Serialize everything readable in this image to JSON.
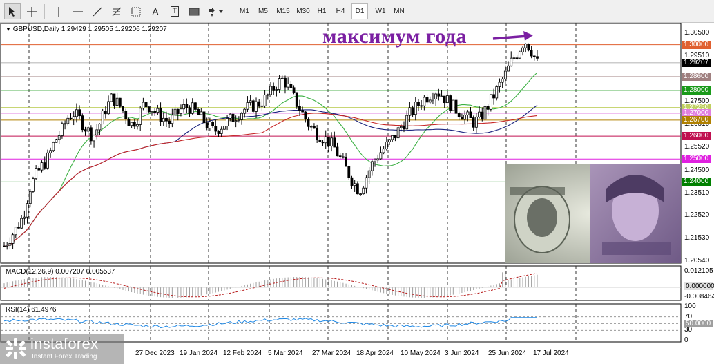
{
  "toolbar": {
    "tools": [
      {
        "name": "cursor-tool",
        "icon": "cursor-icon"
      },
      {
        "name": "crosshair-tool",
        "icon": "crosshair-icon"
      },
      {
        "name": "vertical-line-tool",
        "icon": "vertical-line-icon"
      },
      {
        "name": "horizontal-line-tool",
        "icon": "horizontal-line-icon"
      },
      {
        "name": "trend-line-tool",
        "icon": "trend-line-icon"
      },
      {
        "name": "fibonacci-tool",
        "icon": "fibonacci-icon"
      },
      {
        "name": "channel-tool",
        "icon": "channel-icon"
      },
      {
        "name": "text-tool",
        "icon": "text-icon",
        "label": "A"
      },
      {
        "name": "text-label-tool",
        "icon": "text-label-icon",
        "label": "T"
      },
      {
        "name": "rectangle-tool",
        "icon": "rectangle-icon"
      },
      {
        "name": "shapes-menu",
        "icon": "shapes-icon"
      }
    ],
    "timeframes": [
      "M1",
      "M5",
      "M15",
      "M30",
      "H1",
      "H4",
      "D1",
      "W1",
      "MN"
    ],
    "active_timeframe": "D1"
  },
  "chart": {
    "header": "GBPUSD,Daily  1.29429 1.29505 1.29206 1.29207",
    "annotation": "максимум года",
    "price_axis": [
      "1.30500",
      "1.29510",
      "1.27500",
      "1.26510",
      "1.25520",
      "1.24500",
      "1.23510",
      "1.22520",
      "1.21530",
      "1.20540"
    ],
    "price_tags": [
      {
        "label": "1.30000",
        "color": "#e06030"
      },
      {
        "label": "1.29207",
        "color": "#000000"
      },
      {
        "label": "1.28600",
        "color": "#a08080"
      },
      {
        "label": "1.28000",
        "color": "#1a9a1a"
      },
      {
        "label": "1.27250",
        "color": "#c0d060"
      },
      {
        "label": "1.27000",
        "color": "#e080e0"
      },
      {
        "label": "1.26700",
        "color": "#b08000"
      },
      {
        "label": "1.26000",
        "color": "#c01050"
      },
      {
        "label": "1.25000",
        "color": "#e020e0"
      },
      {
        "label": "1.24000",
        "color": "#008000"
      }
    ],
    "date_axis": [
      "27 Dec 2023",
      "19 Jan 2024",
      "12 Feb 2024",
      "5 Mar 2024",
      "27 Mar 2024",
      "18 Apr 2024",
      "10 May 2024",
      "3 Jun 2024",
      "25 Jun 2024",
      "17 Jul 2024"
    ]
  },
  "macd": {
    "label": "MACD(12,26,9) 0.007207 0.005537",
    "axis": [
      "0.012105",
      "0.000000",
      "-0.008464"
    ]
  },
  "rsi": {
    "label": "RSI(14) 61.4976",
    "axis": [
      "100",
      "70",
      "50.0000",
      "30",
      "0"
    ]
  },
  "watermark": {
    "name": "instaforex",
    "tagline": "Instant Forex Trading"
  },
  "chart_data": {
    "type": "candlestick",
    "symbol": "GBPUSD",
    "timeframe": "Daily",
    "last_ohlc": {
      "open": 1.29429,
      "high": 1.29505,
      "low": 1.29206,
      "close": 1.29207
    },
    "closes": [
      1.212,
      1.216,
      1.22,
      1.225,
      1.237,
      1.243,
      1.247,
      1.251,
      1.258,
      1.262,
      1.268,
      1.27,
      1.267,
      1.263,
      1.26,
      1.265,
      1.272,
      1.277,
      1.274,
      1.27,
      1.265,
      1.268,
      1.274,
      1.273,
      1.27,
      1.268,
      1.266,
      1.269,
      1.272,
      1.273,
      1.271,
      1.268,
      1.265,
      1.262,
      1.264,
      1.266,
      1.268,
      1.27,
      1.272,
      1.273,
      1.274,
      1.276,
      1.279,
      1.283,
      1.285,
      1.28,
      1.275,
      1.27,
      1.265,
      1.262,
      1.26,
      1.258,
      1.255,
      1.25,
      1.245,
      1.24,
      1.236,
      1.242,
      1.248,
      1.252,
      1.255,
      1.258,
      1.262,
      1.266,
      1.27,
      1.273,
      1.276,
      1.278,
      1.28,
      1.278,
      1.275,
      1.272,
      1.27,
      1.268,
      1.266,
      1.268,
      1.272,
      1.277,
      1.282,
      1.287,
      1.293,
      1.297,
      1.302,
      1.298,
      1.292
    ],
    "horizontal_levels": [
      1.3,
      1.286,
      1.28,
      1.2725,
      1.27,
      1.267,
      1.26,
      1.25,
      1.24
    ],
    "ylim": [
      1.2054,
      1.305
    ],
    "annotation": "максимум года",
    "indicators": {
      "macd": {
        "params": "12,26,9",
        "main": 0.007207,
        "signal": 0.005537
      },
      "rsi": {
        "period": 14,
        "value": 61.4976,
        "levels": [
          70,
          50,
          30
        ]
      }
    }
  }
}
